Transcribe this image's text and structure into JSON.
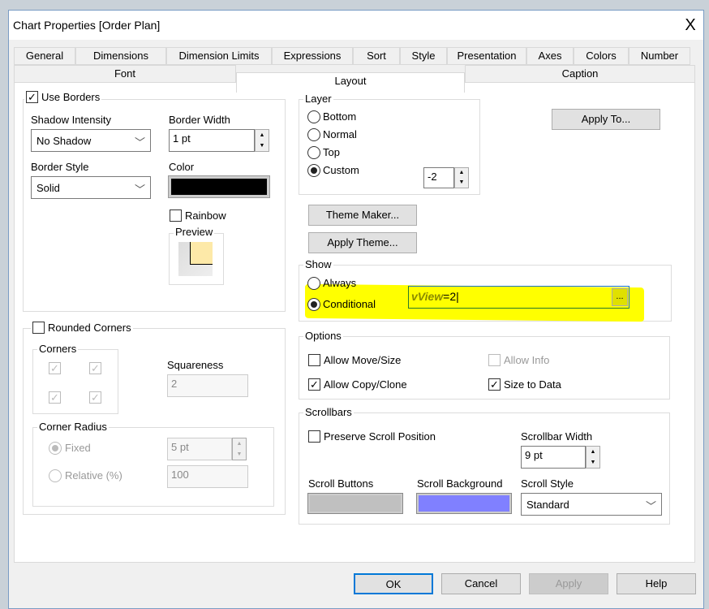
{
  "window": {
    "title": "Chart Properties [Order Plan]",
    "close": "X"
  },
  "tabs_row1": [
    "General",
    "Dimensions",
    "Dimension Limits",
    "Expressions",
    "Sort",
    "Style",
    "Presentation",
    "Axes",
    "Colors",
    "Number"
  ],
  "tabs_row2": [
    "Font",
    "Layout",
    "Caption"
  ],
  "active_tab": "Layout",
  "borders": {
    "use_borders_label": "Use Borders",
    "use_borders_checked": true,
    "shadow_label": "Shadow Intensity",
    "shadow_value": "No Shadow",
    "width_label": "Border Width",
    "width_value": "1 pt",
    "style_label": "Border Style",
    "style_value": "Solid",
    "color_label": "Color",
    "color_value": "#000000",
    "rainbow_label": "Rainbow",
    "rainbow_checked": false,
    "preview_label": "Preview"
  },
  "rounded": {
    "label": "Rounded Corners",
    "checked": false,
    "corners_label": "Corners",
    "squareness_label": "Squareness",
    "squareness_value": "2",
    "radius_label": "Corner Radius",
    "fixed_label": "Fixed",
    "fixed_value": "5 pt",
    "relative_label": "Relative (%)",
    "relative_value": "100"
  },
  "layer": {
    "label": "Layer",
    "options": [
      "Bottom",
      "Normal",
      "Top",
      "Custom"
    ],
    "selected": "Custom",
    "custom_value": "-2"
  },
  "theme": {
    "maker": "Theme Maker...",
    "apply": "Apply Theme..."
  },
  "apply_to": "Apply To...",
  "show": {
    "label": "Show",
    "always": "Always",
    "conditional": "Conditional",
    "selected": "Conditional",
    "expr_var": "vView",
    "expr_rest": "=2",
    "ellipsis": "...",
    "highlight": "#ffff00"
  },
  "options": {
    "label": "Options",
    "move": "Allow Move/Size",
    "move_checked": false,
    "info": "Allow Info",
    "info_checked": false,
    "copy": "Allow Copy/Clone",
    "copy_checked": true,
    "size": "Size to Data",
    "size_checked": true
  },
  "scrollbars": {
    "label": "Scrollbars",
    "preserve": "Preserve Scroll Position",
    "preserve_checked": false,
    "width_label": "Scrollbar Width",
    "width_value": "9 pt",
    "buttons_label": "Scroll Buttons",
    "buttons_color": "#c0c0c0",
    "bg_label": "Scroll Background",
    "bg_color": "#8080ff",
    "style_label": "Scroll Style",
    "style_value": "Standard"
  },
  "footer": {
    "ok": "OK",
    "cancel": "Cancel",
    "apply": "Apply",
    "help": "Help"
  }
}
